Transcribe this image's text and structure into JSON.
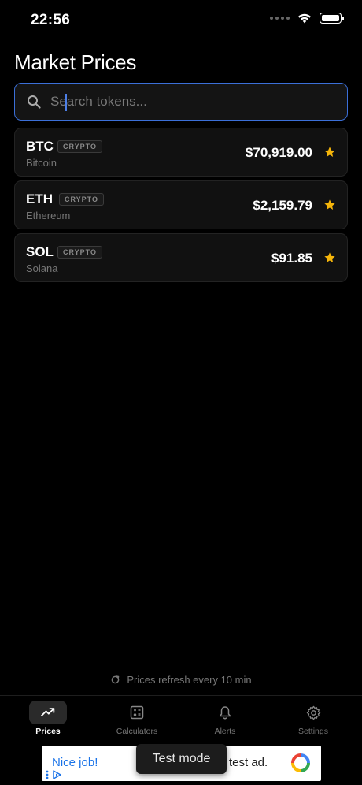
{
  "status_bar": {
    "time": "22:56"
  },
  "header": {
    "title": "Market Prices"
  },
  "search": {
    "placeholder": "Search tokens..."
  },
  "tokens": [
    {
      "symbol": "BTC",
      "tag": "CRYPTO",
      "name": "Bitcoin",
      "price": "$70,919.00",
      "favorite": true
    },
    {
      "symbol": "ETH",
      "tag": "CRYPTO",
      "name": "Ethereum",
      "price": "$2,159.79",
      "favorite": true
    },
    {
      "symbol": "SOL",
      "tag": "CRYPTO",
      "name": "Solana",
      "price": "$91.85",
      "favorite": true
    }
  ],
  "footer_note": "Prices refresh every 10 min",
  "tabs": [
    {
      "label": "Prices",
      "icon": "trending-up-icon",
      "active": true
    },
    {
      "label": "Calculators",
      "icon": "calculator-icon",
      "active": false
    },
    {
      "label": "Alerts",
      "icon": "bell-icon",
      "active": false
    },
    {
      "label": "Settings",
      "icon": "gear-icon",
      "active": false
    }
  ],
  "ad": {
    "headline": "Nice job!",
    "body": "test ad.",
    "toast": "Test mode"
  },
  "colors": {
    "accent": "#3b6fd8",
    "star": "#f5b50a",
    "background": "#000000"
  }
}
